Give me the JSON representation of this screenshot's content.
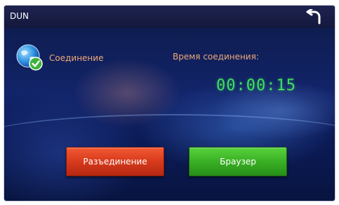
{
  "window": {
    "title": "DUN"
  },
  "icons": {
    "back": "back-arrow-icon",
    "status": "globe-check-icon"
  },
  "connection": {
    "status_label": "Соединение",
    "time_label": "Время соединения:",
    "elapsed": "00:00:15"
  },
  "buttons": {
    "disconnect_label": "Разъединение",
    "browser_label": "Браузер"
  },
  "colors": {
    "label_orange": "#f0a878",
    "timer_green": "#3fe05a",
    "disconnect_red": "#d73a1c",
    "browser_green": "#39b024"
  }
}
